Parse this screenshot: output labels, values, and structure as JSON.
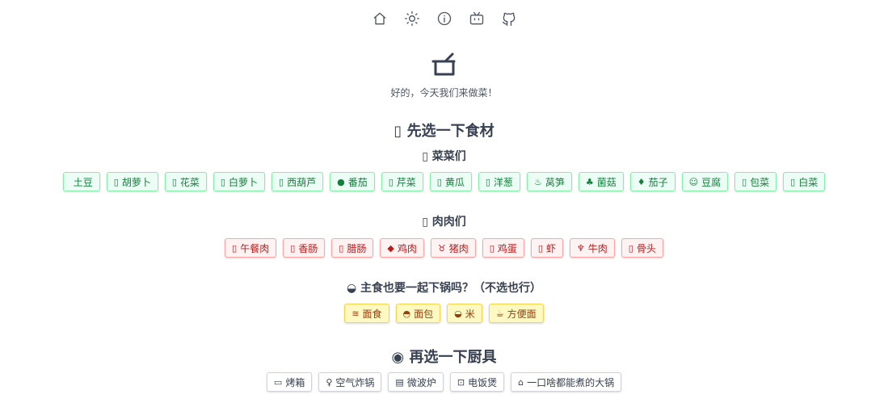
{
  "nav": [
    {
      "name": "home-icon"
    },
    {
      "name": "sun-icon"
    },
    {
      "name": "info-icon"
    },
    {
      "name": "bilibili-icon"
    },
    {
      "name": "github-icon"
    }
  ],
  "tagline": "好的，今天我们来做菜！",
  "section1": {
    "title": "先选一下食材",
    "icon": "▯"
  },
  "vegetables": {
    "title": "菜菜们",
    "icon": "▯",
    "items": [
      {
        "icon": "",
        "label": "土豆"
      },
      {
        "icon": "▯",
        "label": "胡萝卜"
      },
      {
        "icon": "▯",
        "label": "花菜"
      },
      {
        "icon": "▯",
        "label": "白萝卜"
      },
      {
        "icon": "▯",
        "label": "西葫芦"
      },
      {
        "icon": "●",
        "label": "番茄"
      },
      {
        "icon": "▯",
        "label": "芹菜"
      },
      {
        "icon": "▯",
        "label": "黄瓜"
      },
      {
        "icon": "▯",
        "label": "洋葱"
      },
      {
        "icon": "♨",
        "label": "莴笋"
      },
      {
        "icon": "♣",
        "label": "菌菇"
      },
      {
        "icon": "♦",
        "label": "茄子"
      },
      {
        "icon": "☺",
        "label": "豆腐"
      },
      {
        "icon": "▯",
        "label": "包菜"
      },
      {
        "icon": "▯",
        "label": "白菜"
      }
    ]
  },
  "meats": {
    "title": "肉肉们",
    "icon": "▯",
    "items": [
      {
        "icon": "▯",
        "label": "午餐肉"
      },
      {
        "icon": "▯",
        "label": "香肠"
      },
      {
        "icon": "▯",
        "label": "腊肠"
      },
      {
        "icon": "◆",
        "label": "鸡肉"
      },
      {
        "icon": "♉",
        "label": "猪肉"
      },
      {
        "icon": "▯",
        "label": "鸡蛋"
      },
      {
        "icon": "▯",
        "label": "虾"
      },
      {
        "icon": "♆",
        "label": "牛肉"
      },
      {
        "icon": "▯",
        "label": "骨头"
      }
    ]
  },
  "staples": {
    "title": "主食也要一起下锅吗？（不选也行）",
    "icon": "◒",
    "items": [
      {
        "icon": "≋",
        "label": "面食"
      },
      {
        "icon": "◓",
        "label": "面包"
      },
      {
        "icon": "◒",
        "label": "米"
      },
      {
        "icon": "☕",
        "label": "方便面"
      }
    ]
  },
  "section2": {
    "title": "再选一下厨具",
    "icon": "◉"
  },
  "tools": {
    "items": [
      {
        "icon": "▭",
        "label": "烤箱"
      },
      {
        "icon": "♀",
        "label": "空气炸锅"
      },
      {
        "icon": "▤",
        "label": "微波炉"
      },
      {
        "icon": "⊡",
        "label": "电饭煲"
      },
      {
        "icon": "⌂",
        "label": "一口啥都能煮的大锅"
      }
    ]
  }
}
